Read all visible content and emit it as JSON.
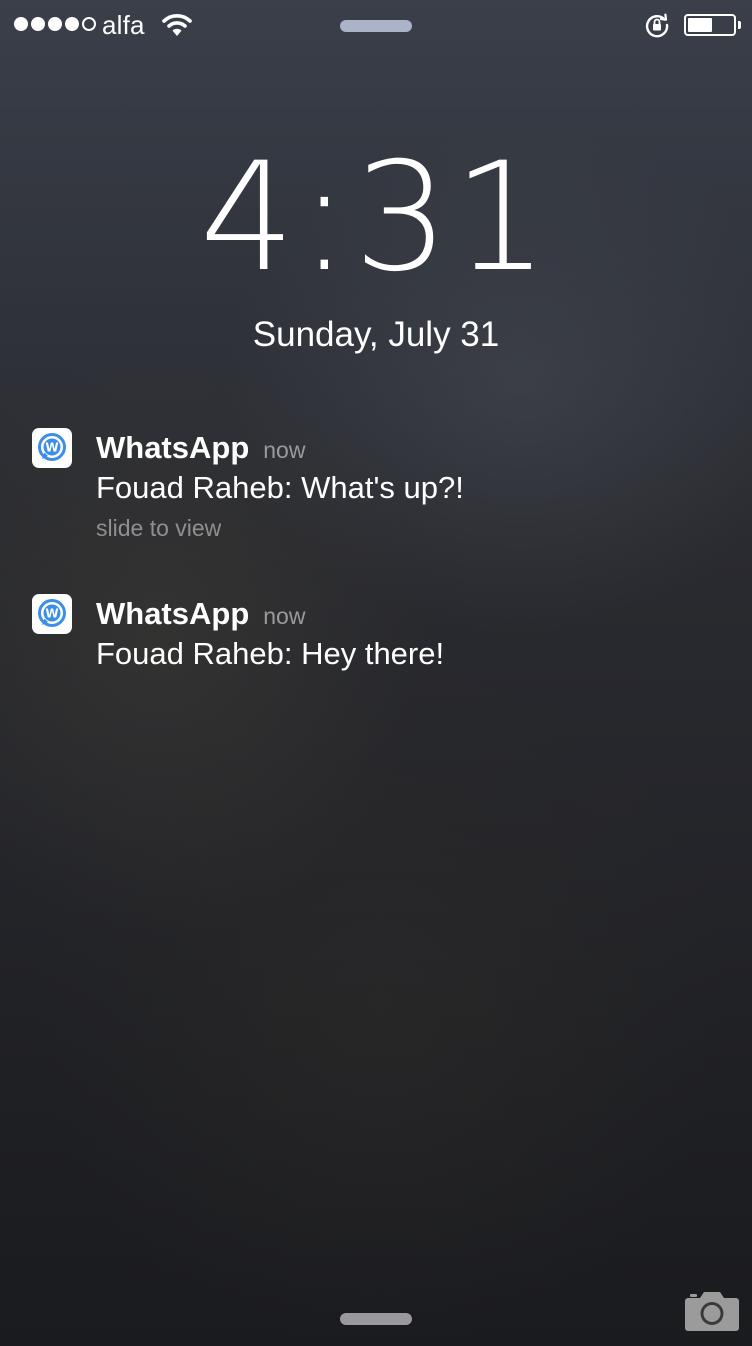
{
  "status_bar": {
    "signal_bars": [
      1,
      1,
      1,
      1,
      0
    ],
    "carrier": "alfa",
    "battery_level": 0.55,
    "icons": [
      "wifi-icon",
      "rotation-lock-icon",
      "battery-icon"
    ]
  },
  "lock_screen": {
    "time": "4:31",
    "date": "Sunday, July 31"
  },
  "notifications": [
    {
      "app": "WhatsApp",
      "time": "now",
      "message": "Fouad Raheb: What's up?!",
      "hint": "slide to view",
      "icon": "whatsapp-app-icon"
    },
    {
      "app": "WhatsApp",
      "time": "now",
      "message": "Fouad Raheb: Hey there!",
      "icon": "whatsapp-app-icon"
    }
  ],
  "bottom": {
    "icons": [
      "camera-icon"
    ]
  },
  "colors": {
    "app_icon_blue": "#3d8ee6",
    "secondary_text": "#9a9a9c"
  }
}
